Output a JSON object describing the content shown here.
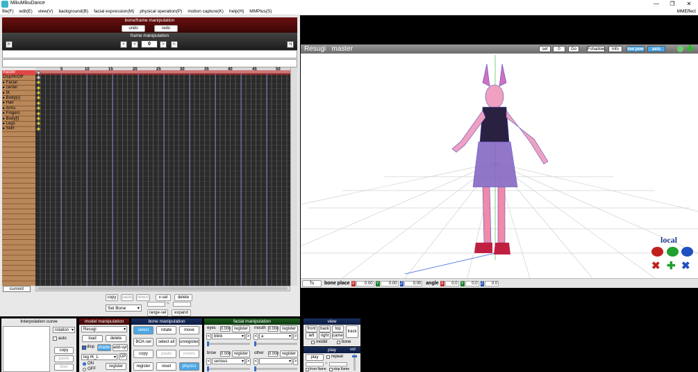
{
  "window": {
    "title": "MikuMikuDance",
    "min": "—",
    "max": "❐",
    "close": "✕"
  },
  "menu": {
    "items": [
      "file(F)",
      "edit(E)",
      "view(V)",
      "background(B)",
      "facial expression(M)",
      "physical operation(P)",
      "motion capture(K)",
      "help(H)",
      "MMPlus(S)"
    ],
    "right": "MMEffect"
  },
  "bone_frame": {
    "title": "bone/frame manipulation",
    "undo": "undo",
    "redo": "redo"
  },
  "frame_manip": {
    "title": "frame manipulation",
    "frame": "0",
    "first": "|<",
    "prev_key": "<",
    "prev": "<",
    "next": ">",
    "next_key": ">.",
    "last": ">|"
  },
  "timeline": {
    "ticks": [
      "5",
      "10",
      "15",
      "20",
      "25",
      "30",
      "35",
      "40",
      "45",
      "50"
    ],
    "rows": [
      "master",
      "Disp/IK/OP",
      "▸ Facial",
      "▸ center",
      "▸ IK",
      "▸ Body[u]",
      "▸ Hair",
      "▸ Arms",
      "▸ Fingers",
      "▸ Body[l]",
      "▸ Legs",
      "▸ Skirt"
    ],
    "current": "current"
  },
  "edit": {
    "copy": "copy",
    "paste": "paste",
    "reverse": "revers",
    "vsel": "v-sel",
    "delete": "delete",
    "sel_bone": "Sel Bone",
    "range_sel": "range-sel",
    "expand": "expand",
    "dash": "~"
  },
  "viewport": {
    "model": "Resugi",
    "bone": "master",
    "set": "set",
    "frame": "0",
    "go": "Go",
    "fshadow": "Fshadow",
    "info": "info",
    "low_pow": "low pow",
    "axis": "axis",
    "local": "local",
    "to_camera": "To camera",
    "bone_place": "bone place",
    "pos": {
      "x": "0.00",
      "y": "0.00",
      "z": "0.00"
    },
    "angle_label": "angle",
    "angle": {
      "x": "0.0",
      "y": "0.0",
      "z": "0.0"
    },
    "axis_x": "X",
    "axis_y": "Y",
    "axis_z": "Z"
  },
  "interp": {
    "title": "Interpolation curve",
    "mode": "rotation",
    "auto": "auto",
    "copy": "copy",
    "paste": "paste",
    "liner": "liner"
  },
  "model_manip": {
    "title": "model manipulation",
    "model": "Resugi",
    "load": "load",
    "delete": "delete",
    "disp": "disp",
    "shadow": "shadow",
    "add_syn": "add-syn",
    "ik": "leg IK_L",
    "op": "OP",
    "on": "ON",
    "off": "OFF",
    "register": "register"
  },
  "bone_manip": {
    "title": "bone manipulation",
    "select": "select",
    "rotate": "rotate",
    "move": "move",
    "box_sel": "BOX-sel",
    "select_all": "select all",
    "unregistered": "unregisted",
    "copy": "copy",
    "paste": "paste",
    "reverse": "revers",
    "register": "register",
    "reset": "reset",
    "physics": "physics"
  },
  "facial": {
    "title": "facial manipulation",
    "eyes": {
      "label": "eyes",
      "value": "0.000",
      "register": "register",
      "morph": "blink"
    },
    "mouth": {
      "label": "mouth",
      "value": "0.000",
      "register": "register",
      "morph": "a"
    },
    "brow": {
      "label": "brow",
      "value": "0.000",
      "register": "register",
      "morph": "serious"
    },
    "other": {
      "label": "other",
      "value": "0.000",
      "register": "register",
      "morph": ""
    },
    "lt": "<",
    "gt": ">"
  },
  "view_panel": {
    "title": "view",
    "front": "front",
    "back": "back",
    "top": "top",
    "track": "track",
    "left": "left",
    "right": "right",
    "camera": "camer",
    "model": "model",
    "bone": "bone"
  },
  "play_panel": {
    "title": "play",
    "play": "play",
    "repeat": "repeat",
    "vol": "vol",
    "from_frame": "from flame",
    "stop_frame": "stop flame",
    "dash": "~"
  },
  "colors": {
    "accent_blue": "#4aa8e8",
    "dark_red": "#6b1010",
    "timeline_brown": "#b9885a"
  }
}
